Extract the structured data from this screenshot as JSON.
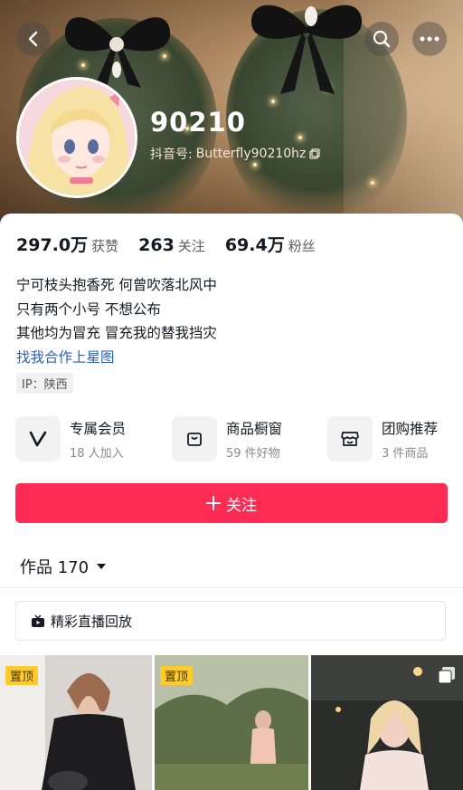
{
  "header": {
    "back_icon": "chevron-left-icon",
    "search_icon": "search-icon",
    "more_icon": "more-dots-icon"
  },
  "profile": {
    "nickname": "90210",
    "douyin_id_label": "抖音号:",
    "douyin_id": "Butterfly90210hz",
    "copy_icon": "copy-icon"
  },
  "stats": [
    {
      "value": "297.0万",
      "label": "获赞"
    },
    {
      "value": "263",
      "label": "关注"
    },
    {
      "value": "69.4万",
      "label": "粉丝"
    }
  ],
  "bio": {
    "lines": [
      "宁可枝头抱香死 何曾吹落北风中",
      "只有两个小号 不想公布",
      "其他均为冒充 冒充我的替我挡灾"
    ],
    "link": "找我合作上星图"
  },
  "ip_label": "IP：陕西",
  "services": [
    {
      "title": "专属会员",
      "subtitle": "18 人加入",
      "icon": "v-member-icon"
    },
    {
      "title": "商品橱窗",
      "subtitle": "59 件好物",
      "icon": "shopping-bag-icon"
    },
    {
      "title": "团购推荐",
      "subtitle": "3 件商品",
      "icon": "store-icon"
    }
  ],
  "follow_button": "关注",
  "works_tab": {
    "label": "作品 170",
    "icon": "caret-down-icon"
  },
  "live_replay": {
    "label": "精彩直播回放",
    "icon": "tv-icon"
  },
  "grid": {
    "pinned_label": "置顶",
    "tiles": [
      {
        "pinned": true
      },
      {
        "pinned": true
      },
      {
        "pinned": false,
        "icon": "multi-image-icon"
      }
    ]
  },
  "colors": {
    "accent": "#fe2c55",
    "link": "#2a5fb5",
    "pin": "#fecb2e"
  }
}
